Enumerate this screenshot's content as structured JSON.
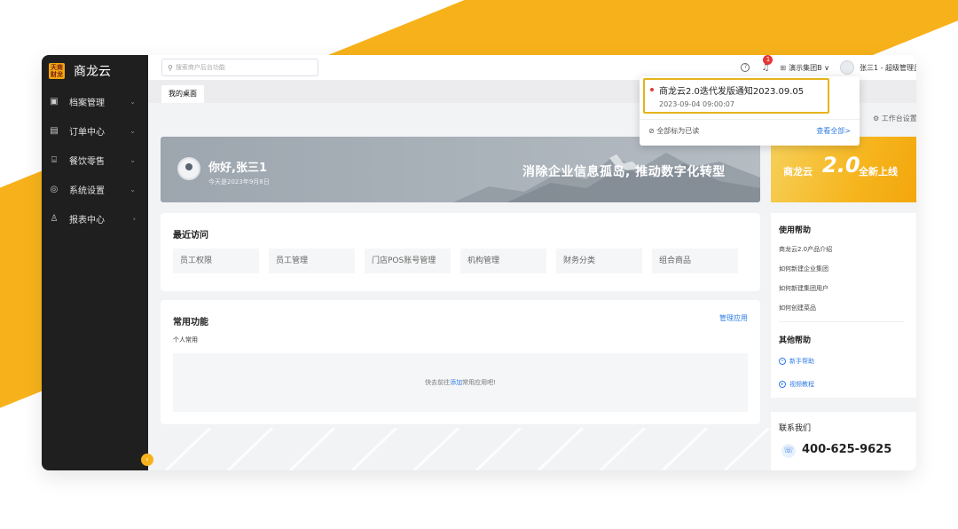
{
  "colors": {
    "accent": "#f7b21b",
    "link": "#2f7be5",
    "sidebar": "#1f1f1f",
    "highlight_border": "#e6b31b"
  },
  "app": {
    "logo_glyph": "天商\n财龙",
    "name": "商龙云"
  },
  "sidebar": {
    "items": [
      {
        "icon": "archive-icon",
        "label": "档案管理"
      },
      {
        "icon": "order-icon",
        "label": "订单中心"
      },
      {
        "icon": "catering-icon",
        "label": "餐饮零售"
      },
      {
        "icon": "settings-icon",
        "label": "系统设置"
      },
      {
        "icon": "report-icon",
        "label": "报表中心"
      }
    ]
  },
  "topbar": {
    "search_placeholder": "搜索商户后台功能",
    "help_icon": "question-icon",
    "notification_count": "1",
    "org_label": "演示集团B ∨",
    "user_label": "张三1 - 超级管理员"
  },
  "tabs": {
    "active": "我的桌面"
  },
  "notification_panel": {
    "title": "商龙云2.0迭代发版通知2023.09.05",
    "time": "2023-09-04 09:00:07",
    "mark_all_read": "全部标为已读",
    "view_all": "查看全部>"
  },
  "workbench_settings": "工作台设置",
  "banner": {
    "greeting": "你好,张三1",
    "date_text": "今天是2023年9月8日",
    "slogan": "消除企业信息孤岛, 推动数字化转型"
  },
  "recent_visits": {
    "title": "最近访问",
    "items": [
      "员工权限",
      "员工管理",
      "门店POS账号管理",
      "机构管理",
      "财务分类",
      "组合商品"
    ]
  },
  "common_functions": {
    "title": "常用功能",
    "manage": "管理应用",
    "personal_label": "个人常用",
    "empty_prefix": "快去前往",
    "empty_link": "添加",
    "empty_suffix": "常用应用吧!"
  },
  "promo": {
    "name": "商龙云",
    "version": "2.0",
    "tail": "全新上线"
  },
  "help": {
    "title": "使用帮助",
    "links": [
      "商龙云2.0产品介绍",
      "如何新建企业集团",
      "如何新建集团用户",
      "如何创建菜品"
    ],
    "other_title": "其他帮助",
    "other_links": [
      "新手帮助",
      "视频教程"
    ]
  },
  "contact": {
    "title": "联系我们",
    "phone": "400-625-9625"
  }
}
